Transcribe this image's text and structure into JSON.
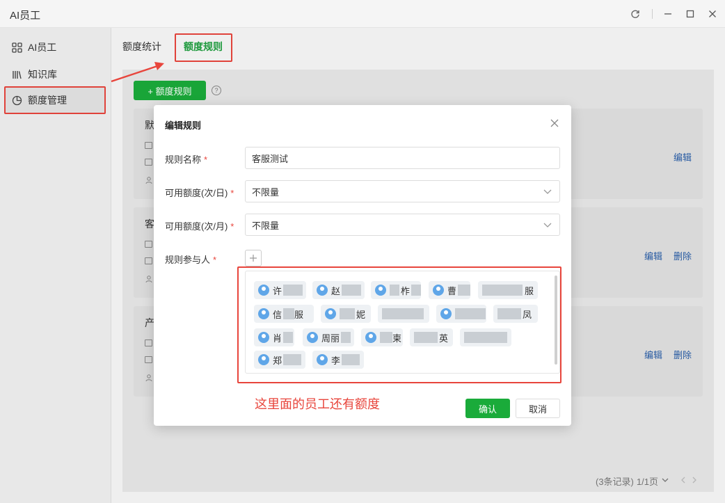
{
  "window": {
    "title": "AI员工"
  },
  "sidebar": {
    "items": [
      {
        "label": "AI员工",
        "icon": "grid-icon"
      },
      {
        "label": "知识库",
        "icon": "books-icon"
      },
      {
        "label": "额度管理",
        "icon": "pie-chart-icon",
        "active": true
      }
    ]
  },
  "tabs": [
    {
      "label": "额度统计"
    },
    {
      "label": "额度规则",
      "active": true
    }
  ],
  "toolbar": {
    "add_label": "+ 额度规则",
    "help": "?"
  },
  "cards": [
    {
      "title": "默",
      "actions": [
        "编辑"
      ]
    },
    {
      "title": "客",
      "actions": [
        "编辑",
        "删除"
      ]
    },
    {
      "title": "产",
      "actions": [
        "编辑",
        "删除"
      ]
    }
  ],
  "pager": {
    "records": "(3条记录)",
    "page": "1/1页"
  },
  "dialog": {
    "title": "编辑规则",
    "fields": {
      "name_label": "规则名称",
      "name_value": "客服测试",
      "daily_label": "可用额度(次/日)",
      "daily_value": "不限量",
      "monthly_label": "可用额度(次/月)",
      "monthly_value": "不限量",
      "people_label": "规则参与人"
    },
    "required_mark": "*",
    "people": [
      {
        "label": "许"
      },
      {
        "label": "赵"
      },
      {
        "label": "柞"
      },
      {
        "label": "曹"
      },
      {
        "label": "服"
      },
      {
        "label": "信"
      },
      {
        "label": "服"
      },
      {
        "label": "妮"
      },
      {
        "label": ""
      },
      {
        "label": ""
      },
      {
        "label": "凤"
      },
      {
        "label": "肖"
      },
      {
        "label": "周丽"
      },
      {
        "label": "柬"
      },
      {
        "label": "英"
      },
      {
        "label": ""
      },
      {
        "label": "郑"
      },
      {
        "label": "李"
      }
    ],
    "annotation": "这里面的员工还有额度",
    "ok_label": "确认",
    "cancel_label": "取消"
  },
  "colors": {
    "accent": "#1aab3a",
    "annotation": "#e8453c",
    "link": "#2a5ea8"
  }
}
